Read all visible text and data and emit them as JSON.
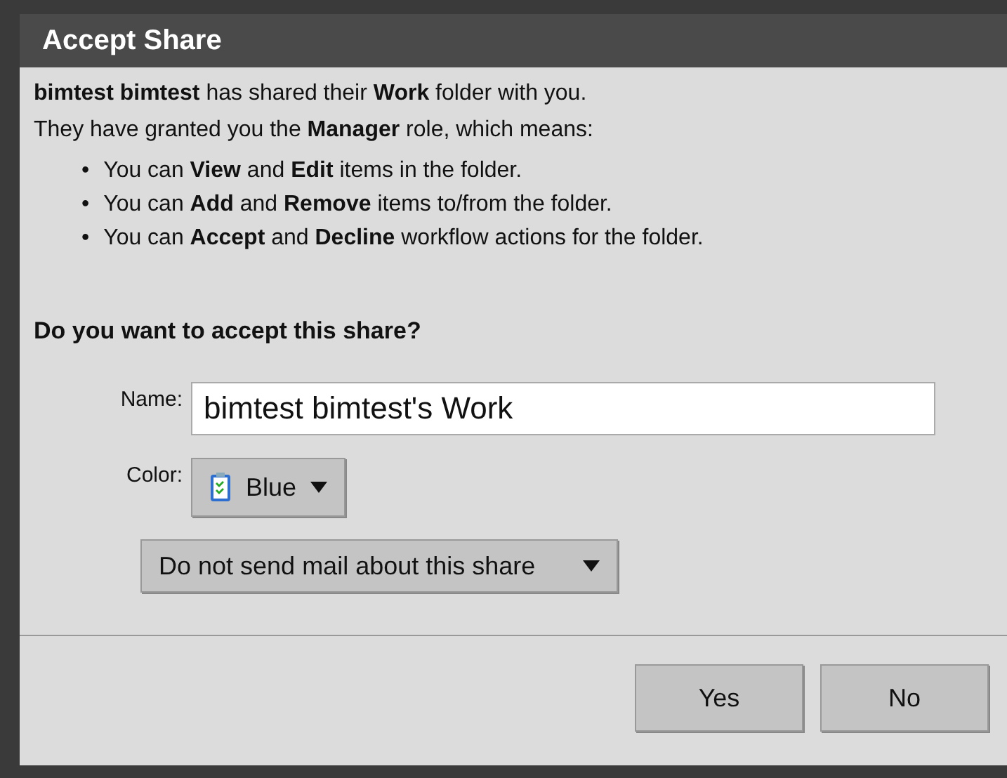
{
  "window": {
    "title": "Accept Share"
  },
  "intro": "**bimtest bimtest** has shared their **Work** folder with you.",
  "role_line": "They have granted you the **Manager** role, which means:",
  "permissions": [
    {
      "bullet": "•",
      "text": "You can **View** and **Edit** items in the folder."
    },
    {
      "bullet": "•",
      "text": "You can **Add** and **Remove** items to/from the folder."
    },
    {
      "bullet": "•",
      "text": "You can **Accept** and **Decline** workflow actions for the folder."
    }
  ],
  "question": "Do you want to accept this share?",
  "name_field": {
    "label": "Name:",
    "value": "bimtest bimtest's Work"
  },
  "color_field": {
    "label": "Color:",
    "value": "Blue"
  },
  "mail_option": "Do not send mail about this share",
  "buttons": [
    "Yes",
    "No"
  ]
}
